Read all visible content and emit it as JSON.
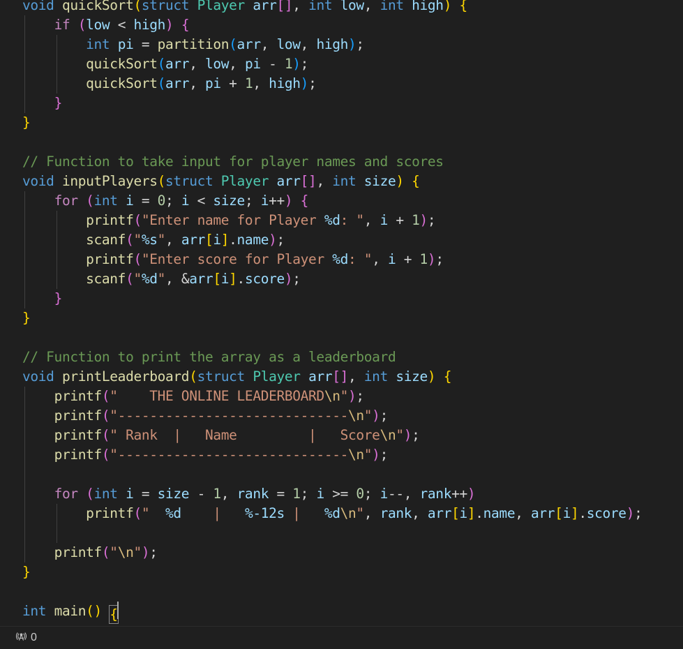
{
  "window": {
    "background": "#1f1f1f",
    "kind": "code-editor"
  },
  "status_bar": {
    "remote_icon": "radio-tower-icon",
    "remote_count": "0"
  },
  "editor": {
    "language": "c",
    "cursor_line_text": "int main() {",
    "theme_colors": {
      "background": "#1f1f1f",
      "foreground": "#cccccc",
      "keyword": "#569cd6",
      "control": "#c586c0",
      "function": "#dcdcaa",
      "type": "#4ec9b0",
      "variable": "#9cdcfe",
      "number": "#b5cea8",
      "string": "#ce9178",
      "escape": "#d7ba7d",
      "comment": "#6a9955",
      "bracket1": "#ffd700",
      "bracket2": "#da70d6",
      "bracket3": "#179fff",
      "indent_guide": "#404040",
      "cursor": "#aeafad"
    },
    "lines": [
      "void quickSort(struct Player arr[], int low, int high) {",
      "    if (low < high) {",
      "        int pi = partition(arr, low, high);",
      "        quickSort(arr, low, pi - 1);",
      "        quickSort(arr, pi + 1, high);",
      "    }",
      "}",
      "",
      "// Function to take input for player names and scores",
      "void inputPlayers(struct Player arr[], int size) {",
      "    for (int i = 0; i < size; i++) {",
      "        printf(\"Enter name for Player %d: \", i + 1);",
      "        scanf(\"%s\", arr[i].name);",
      "        printf(\"Enter score for Player %d: \", i + 1);",
      "        scanf(\"%d\", &arr[i].score);",
      "    }",
      "}",
      "",
      "// Function to print the array as a leaderboard",
      "void printLeaderboard(struct Player arr[], int size) {",
      "    printf(\"    THE ONLINE LEADERBOARD\\n\");",
      "    printf(\"-----------------------------\\n\");",
      "    printf(\" Rank  |   Name         |   Score\\n\");",
      "    printf(\"-----------------------------\\n\");",
      "",
      "    for (int i = size - 1, rank = 1; i >= 0; i--, rank++)",
      "        printf(\"  %d    |   %-12s |   %d\\n\", rank, arr[i].name, arr[i].score);",
      "",
      "    printf(\"\\n\");",
      "}",
      "",
      "int main() {"
    ]
  }
}
